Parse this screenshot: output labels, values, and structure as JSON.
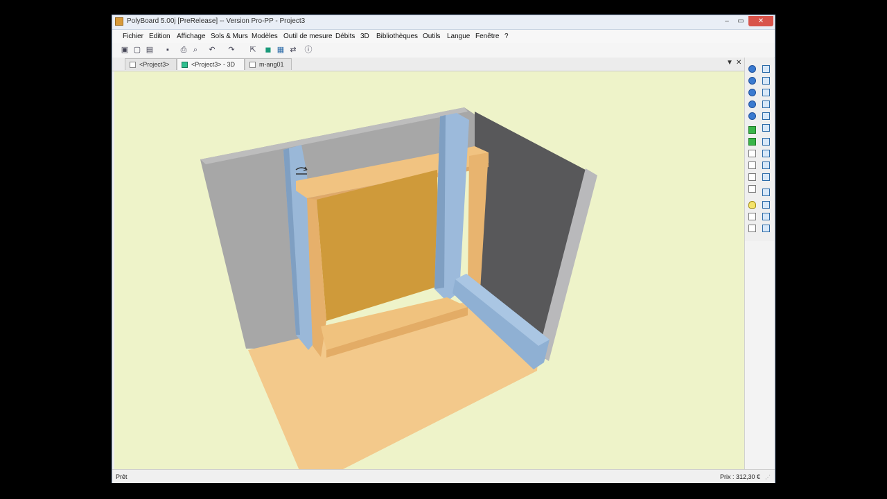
{
  "window": {
    "title": "PolyBoard 5.00j [PreRelease] -- Version Pro-PP - Project3",
    "controls": {
      "minimize": "–",
      "maximize": "▭",
      "close": "✕"
    }
  },
  "menu": {
    "items": [
      "Fichier",
      "Edition",
      "Affichage",
      "Sols & Murs",
      "Modèles",
      "Outil de mesure",
      "Débits",
      "3D",
      "Bibliothèques",
      "Outils",
      "Langue",
      "Fenêtre",
      "?"
    ]
  },
  "toolbar": {
    "buttons": [
      {
        "icon": "new-document-icon",
        "glyph": "▣"
      },
      {
        "icon": "new-file-icon",
        "glyph": "▢"
      },
      {
        "icon": "open-folder-icon",
        "glyph": "▤"
      },
      {
        "icon": "save-icon",
        "glyph": "▪"
      },
      {
        "icon": "print-icon",
        "glyph": "⎙"
      },
      {
        "icon": "print-preview-icon",
        "glyph": "⌕"
      },
      {
        "icon": "undo-icon",
        "glyph": "↶"
      },
      {
        "icon": "redo-icon",
        "glyph": "↷"
      },
      {
        "icon": "export-icon",
        "glyph": "⇱"
      },
      {
        "icon": "cube-view-icon",
        "glyph": "◼"
      },
      {
        "icon": "window-view-icon",
        "glyph": "▦"
      },
      {
        "icon": "arrows-icon",
        "glyph": "⇄"
      },
      {
        "icon": "info-icon",
        "glyph": "ⓘ"
      }
    ]
  },
  "tabs": [
    {
      "label": "<Project3>",
      "icon": "document-icon",
      "active": false
    },
    {
      "label": "<Project3> - 3D",
      "icon": "cube-icon",
      "active": true
    },
    {
      "label": "m-ang01",
      "icon": "document-icon",
      "active": false
    }
  ],
  "tab_controls": {
    "dropdown": "▼",
    "close": "✕"
  },
  "status": {
    "left": "Prêt",
    "right": "Prix : 312,30 €"
  },
  "colors": {
    "viewport_bg": "#eef3c9",
    "wall_left": "#a8a8a8",
    "wall_right": "#5b5b5d",
    "floor": "#f3c98b",
    "panel": "#f0c27e",
    "wood": "#cf9a3a",
    "column": "#9ab8d8"
  }
}
